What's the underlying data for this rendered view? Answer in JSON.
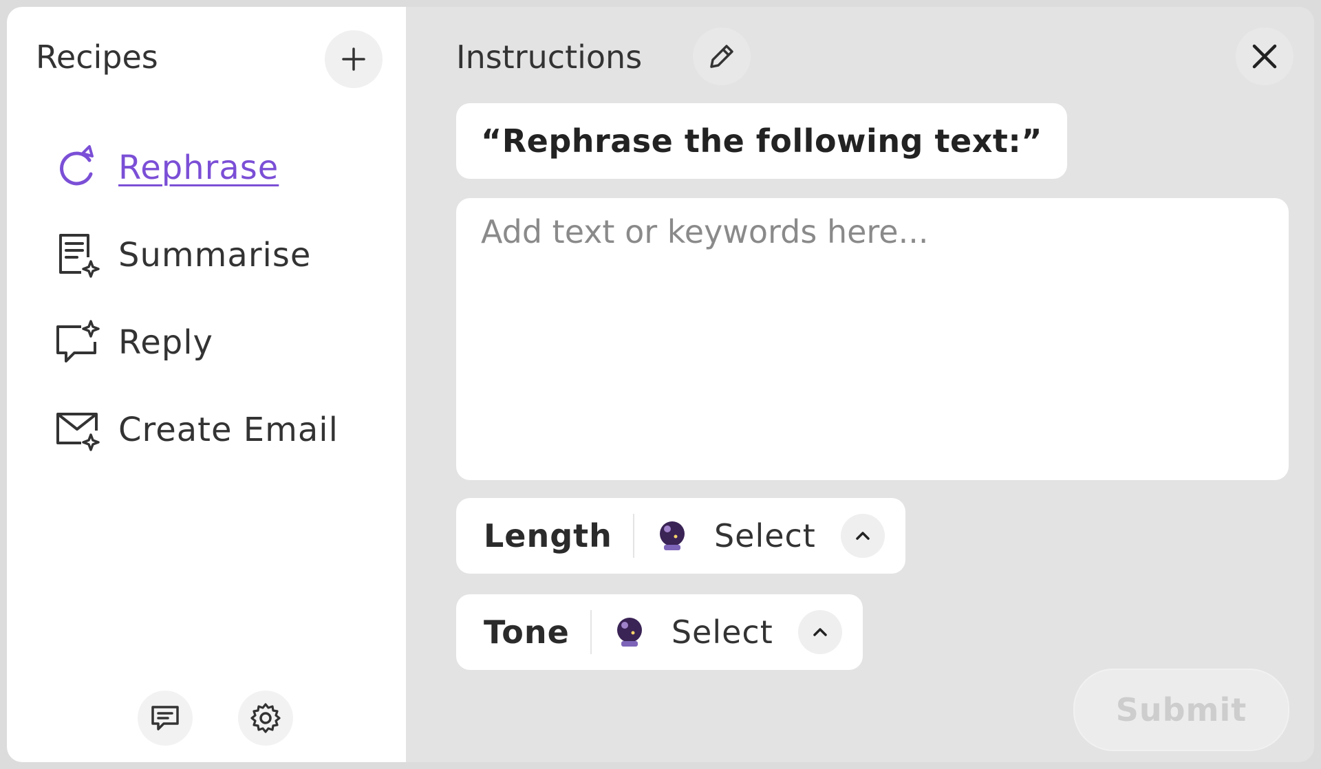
{
  "sidebar": {
    "title": "Recipes",
    "items": [
      {
        "label": "Rephrase",
        "icon": "rephrase-icon",
        "active": true
      },
      {
        "label": "Summarise",
        "icon": "summarise-icon",
        "active": false
      },
      {
        "label": "Reply",
        "icon": "reply-icon",
        "active": false
      },
      {
        "label": "Create Email",
        "icon": "create-email-icon",
        "active": false
      }
    ],
    "footer_icons": [
      "feedback-icon",
      "gear-icon"
    ]
  },
  "main": {
    "title": "Instructions",
    "prompt": "“Rephrase the following text:”",
    "input_placeholder": "Add text or keywords here...",
    "options": [
      {
        "label": "Length",
        "value": "Select"
      },
      {
        "label": "Tone",
        "value": "Select"
      }
    ],
    "submit_label": "Submit"
  },
  "colors": {
    "accent": "#7b4fd6",
    "sidebar_bg": "#ffffff",
    "main_bg": "#e3e3e3"
  }
}
